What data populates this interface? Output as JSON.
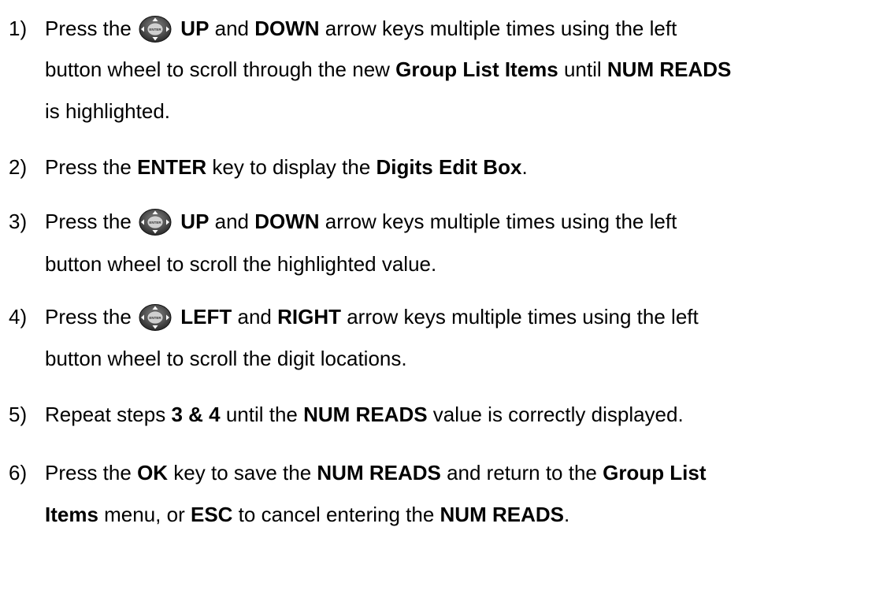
{
  "steps": [
    {
      "number": "1)",
      "lines": [
        {
          "segments": [
            {
              "text": "Press the ",
              "bold": false
            },
            {
              "icon": "button-wheel-icon"
            },
            {
              "text": " UP",
              "bold": true
            },
            {
              "text": " and ",
              "bold": false
            },
            {
              "text": "DOWN",
              "bold": true
            },
            {
              "text": " arrow keys multiple times using the left",
              "bold": false
            }
          ]
        },
        {
          "segments": [
            {
              "text": "button wheel to scroll through the new ",
              "bold": false
            },
            {
              "text": "Group List Items",
              "bold": true
            },
            {
              "text": " until ",
              "bold": false
            },
            {
              "text": "NUM READS",
              "bold": true
            }
          ]
        },
        {
          "segments": [
            {
              "text": "is highlighted.",
              "bold": false
            }
          ]
        }
      ]
    },
    {
      "number": "2)",
      "lines": [
        {
          "segments": [
            {
              "text": "Press the ",
              "bold": false
            },
            {
              "text": "ENTER",
              "bold": true
            },
            {
              "text": " key to display the ",
              "bold": false
            },
            {
              "text": "Digits Edit Box",
              "bold": true
            },
            {
              "text": ".",
              "bold": false
            }
          ]
        }
      ]
    },
    {
      "number": "3)",
      "lines": [
        {
          "segments": [
            {
              "text": "Press the ",
              "bold": false
            },
            {
              "icon": "button-wheel-icon"
            },
            {
              "text": " UP",
              "bold": true
            },
            {
              "text": " and ",
              "bold": false
            },
            {
              "text": "DOWN",
              "bold": true
            },
            {
              "text": " arrow keys multiple times using the left",
              "bold": false
            }
          ]
        },
        {
          "segments": [
            {
              "text": "button wheel to scroll the highlighted value.",
              "bold": false
            }
          ]
        }
      ]
    },
    {
      "number": "4)",
      "lines": [
        {
          "segments": [
            {
              "text": "Press the ",
              "bold": false
            },
            {
              "icon": "button-wheel-icon"
            },
            {
              "text": " LEFT",
              "bold": true
            },
            {
              "text": " and ",
              "bold": false
            },
            {
              "text": "RIGHT",
              "bold": true
            },
            {
              "text": " arrow keys multiple times using the left",
              "bold": false
            }
          ]
        },
        {
          "segments": [
            {
              "text": "button wheel to scroll the digit locations.",
              "bold": false
            }
          ]
        }
      ]
    },
    {
      "number": "5)",
      "lines": [
        {
          "segments": [
            {
              "text": "Repeat steps ",
              "bold": false
            },
            {
              "text": "3 & 4",
              "bold": true
            },
            {
              "text": " until the ",
              "bold": false
            },
            {
              "text": "NUM READS",
              "bold": true
            },
            {
              "text": " value is correctly displayed.",
              "bold": false
            }
          ]
        }
      ]
    },
    {
      "number": "6)",
      "lines": [
        {
          "segments": [
            {
              "text": "Press the ",
              "bold": false
            },
            {
              "text": "OK",
              "bold": true
            },
            {
              "text": " key to save the ",
              "bold": false
            },
            {
              "text": "NUM READS",
              "bold": true
            },
            {
              "text": " and return to the ",
              "bold": false
            },
            {
              "text": "Group List",
              "bold": true
            }
          ]
        },
        {
          "segments": [
            {
              "text": "Items",
              "bold": true
            },
            {
              "text": " menu, or ",
              "bold": false
            },
            {
              "text": "ESC",
              "bold": true
            },
            {
              "text": " to cancel entering the ",
              "bold": false
            },
            {
              "text": "NUM READS",
              "bold": true
            },
            {
              "text": ".",
              "bold": false
            }
          ]
        }
      ]
    }
  ],
  "icon_label": "ENTER"
}
